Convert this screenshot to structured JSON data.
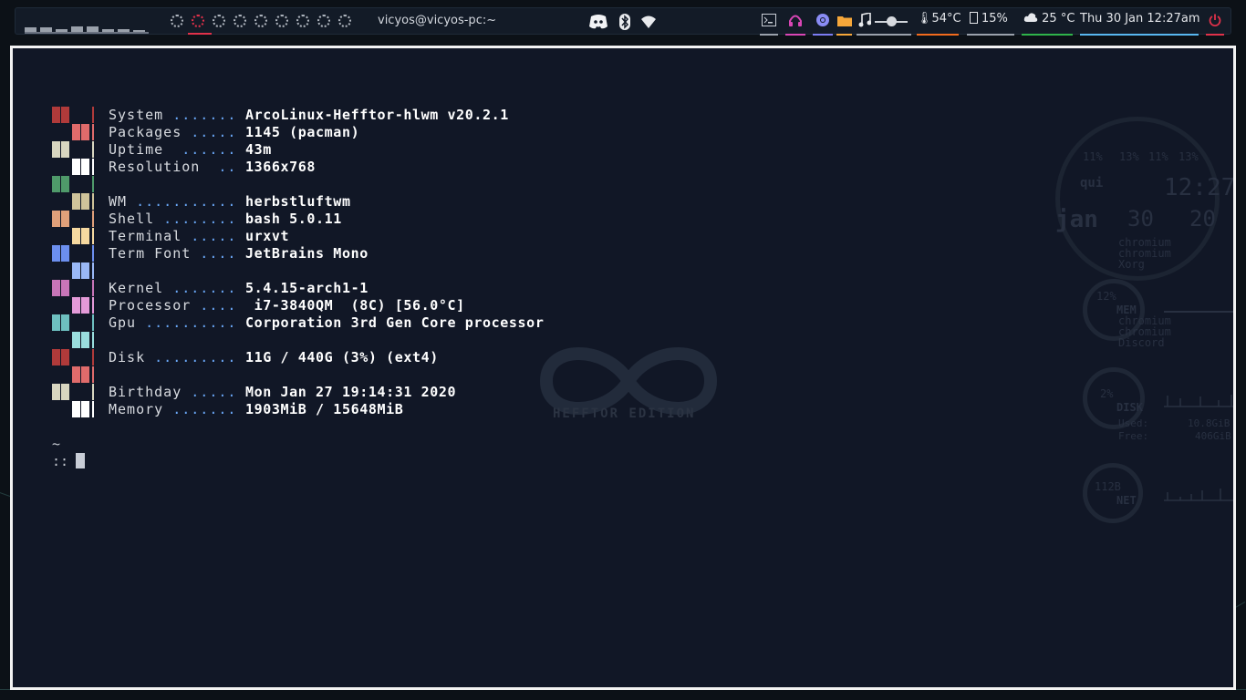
{
  "topbar": {
    "cpu_bars": [
      0.25,
      0.25,
      0.15,
      0.3,
      0.3,
      0.15,
      0.15,
      0.1
    ],
    "workspaces": [
      {
        "name": "ws-1",
        "active": false
      },
      {
        "name": "ws-2",
        "active": true
      },
      {
        "name": "ws-3",
        "active": false
      },
      {
        "name": "ws-4",
        "active": false
      },
      {
        "name": "ws-5",
        "active": false
      },
      {
        "name": "ws-6",
        "active": false
      },
      {
        "name": "ws-7",
        "active": false
      },
      {
        "name": "ws-8",
        "active": false
      },
      {
        "name": "ws-9",
        "active": false
      }
    ],
    "window_title": "vicyos@vicyos-pc:~",
    "center_icons": [
      "discord-icon",
      "bluetooth-icon",
      "wifi-icon"
    ],
    "right": {
      "terminal_icon": "terminal-icon",
      "headphones_icon": "headphones-icon",
      "browser_icon": "chromium-icon",
      "folder_icon": "folder-icon",
      "music_icon": "music-icon",
      "volume_level": 0.5,
      "temp": "54°C",
      "memory": "15%",
      "weather": "25 °C",
      "datetime": "Thu 30 Jan 12:27am",
      "power_icon": "power-icon"
    },
    "colors": {
      "active_ws": "#e0314a",
      "terminal_ul": "#9aa1ab",
      "headphones_ul": "#d946b5",
      "browser_ul": "#7c7cf2",
      "folder_ul": "#f6a73a",
      "music_ul": "#9aa1ab",
      "temp_ul": "#f26b1d",
      "mem_ul": "#9aa1ab",
      "weather_ul": "#2fb34a",
      "date_ul": "#58b7f0",
      "power_ul": "#e0314a"
    }
  },
  "wallpaper": {
    "edition_text": "HEFFTOR EDITION"
  },
  "conky": {
    "cpu_pcts": [
      "11%",
      "13%",
      "11%",
      "13%"
    ],
    "day": "qui",
    "time": "12:27",
    "month": "jan",
    "date_nums": [
      "30",
      "20"
    ],
    "cpu_procs": [
      "chromium",
      "chromium",
      "Xorg"
    ],
    "mem_pct": "12%",
    "mem_label": "MEM",
    "mem_procs": [
      "chromium",
      "chromium",
      "Discord"
    ],
    "disk_pct": "2%",
    "disk_label": "DISK",
    "disk_used_label": "Used:",
    "disk_used": "10.8GiB",
    "disk_free_label": "Free:",
    "disk_free": "406GiB",
    "net_value": "112B",
    "net_label": "NET"
  },
  "neofetch": {
    "rows": [
      {
        "label": "System",
        "dots": " .......",
        "value": "ArcoLinux-Hefftor-hlwm v20.2.1"
      },
      {
        "label": "Packages",
        "dots": " .....",
        "value": "1145 (pacman)"
      },
      {
        "label": "Uptime",
        "dots": "  ......",
        "value": "43m"
      },
      {
        "label": "Resolution",
        "dots": "  ..",
        "value": "1366x768"
      },
      {
        "label": "",
        "dots": "",
        "value": ""
      },
      {
        "label": "WM",
        "dots": " ...........",
        "value": "herbstluftwm"
      },
      {
        "label": "Shell",
        "dots": " ........",
        "value": "bash 5.0.11"
      },
      {
        "label": "Terminal",
        "dots": " .....",
        "value": "urxvt"
      },
      {
        "label": "Term Font",
        "dots": " ....",
        "value": "JetBrains Mono"
      },
      {
        "label": "",
        "dots": "",
        "value": ""
      },
      {
        "label": "Kernel",
        "dots": " .......",
        "value": "5.4.15-arch1-1"
      },
      {
        "label": "Processor",
        "dots": " ....",
        "value": " i7-3840QM  (8C) [56.0°C]"
      },
      {
        "label": "Gpu",
        "dots": " ..........",
        "value": "Corporation 3rd Gen Core processor"
      },
      {
        "label": "",
        "dots": "",
        "value": ""
      },
      {
        "label": "Disk",
        "dots": " .........",
        "value": "11G / 440G (3%) (ext4)"
      },
      {
        "label": "",
        "dots": "",
        "value": ""
      },
      {
        "label": "Birthday",
        "dots": " .....",
        "value": "Mon Jan 27 19:14:31 2020"
      },
      {
        "label": "Memory",
        "dots": " .......",
        "value": "1903MiB / 15648MiB"
      }
    ],
    "palette": [
      {
        "left": "#b03a3a",
        "right": null,
        "pipe": "#b03a3a"
      },
      {
        "left": null,
        "right": "#e06b6b",
        "pipe": "#e06b6b"
      },
      {
        "left": "#d8d6c0",
        "right": null,
        "pipe": "#d8d6c0"
      },
      {
        "left": null,
        "right": "#ffffff",
        "pipe": "#ffffff"
      },
      {
        "left": "#4f9a6a",
        "right": null,
        "pipe": "#4f9a6a"
      },
      {
        "left": null,
        "right": "#cfc39a",
        "pipe": "#cfc39a"
      },
      {
        "left": "#e0a07a",
        "right": null,
        "pipe": "#e0a07a"
      },
      {
        "left": null,
        "right": "#f6d9a0",
        "pipe": "#f6d9a0"
      },
      {
        "left": "#6c8fef",
        "right": null,
        "pipe": "#6c8fef"
      },
      {
        "left": null,
        "right": "#9ab8f6",
        "pipe": "#9ab8f6"
      },
      {
        "left": "#c875b8",
        "right": null,
        "pipe": "#c875b8"
      },
      {
        "left": null,
        "right": "#e49ad8",
        "pipe": "#e49ad8"
      },
      {
        "left": "#6ec0c0",
        "right": null,
        "pipe": "#6ec0c0"
      },
      {
        "left": null,
        "right": "#9adede",
        "pipe": "#9adede"
      },
      {
        "left": "#b03a3a",
        "right": null,
        "pipe": "#b03a3a"
      },
      {
        "left": null,
        "right": "#e06b6b",
        "pipe": "#e06b6b"
      },
      {
        "left": "#d8d6c0",
        "right": null,
        "pipe": "#d8d6c0"
      },
      {
        "left": null,
        "right": "#ffffff",
        "pipe": "#ffffff"
      }
    ]
  },
  "prompt": {
    "cwd": "~",
    "symbol": "::"
  }
}
